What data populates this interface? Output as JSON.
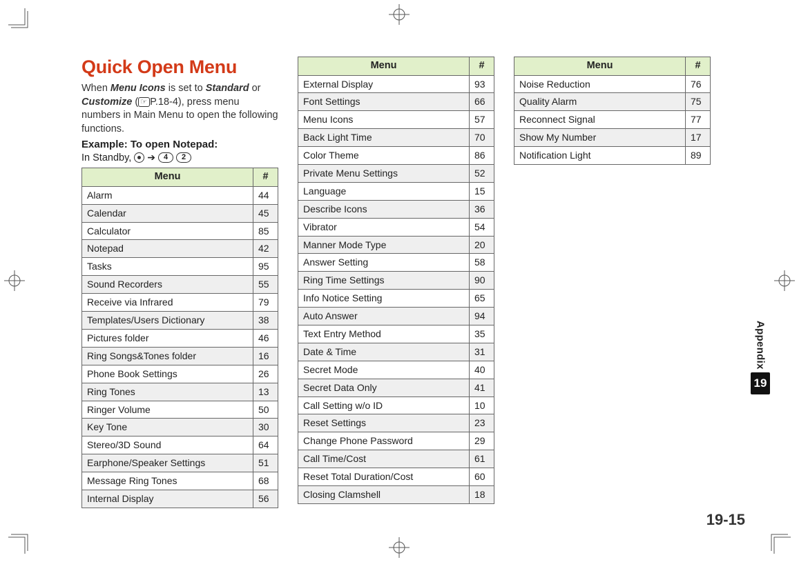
{
  "title": "Quick Open Menu",
  "intro": {
    "pre": "When ",
    "menu_icons": "Menu Icons",
    "mid1": " is set to ",
    "standard": "Standard",
    "or": " or ",
    "customize": "Customize",
    "ref_open": " (",
    "ref_icon_text": "☞",
    "ref_text": "P.18-4), press menu numbers in Main Menu to open the following functions."
  },
  "example_label": "Example: To open Notepad:",
  "standby": {
    "text": "In Standby,",
    "key1": "4",
    "key2": "2"
  },
  "headers": {
    "menu": "Menu",
    "num": "#"
  },
  "table1": [
    {
      "m": "Alarm",
      "n": "44"
    },
    {
      "m": "Calendar",
      "n": "45"
    },
    {
      "m": "Calculator",
      "n": "85"
    },
    {
      "m": "Notepad",
      "n": "42"
    },
    {
      "m": "Tasks",
      "n": "95"
    },
    {
      "m": "Sound Recorders",
      "n": "55"
    },
    {
      "m": "Receive via Infrared",
      "n": "79"
    },
    {
      "m": "Templates/Users Dictionary",
      "n": "38"
    },
    {
      "m": "Pictures folder",
      "n": "46"
    },
    {
      "m": "Ring Songs&Tones folder",
      "n": "16"
    },
    {
      "m": "Phone Book Settings",
      "n": "26"
    },
    {
      "m": "Ring Tones",
      "n": "13"
    },
    {
      "m": "Ringer Volume",
      "n": "50"
    },
    {
      "m": "Key Tone",
      "n": "30"
    },
    {
      "m": "Stereo/3D Sound",
      "n": "64"
    },
    {
      "m": "Earphone/Speaker Settings",
      "n": "51"
    },
    {
      "m": "Message Ring Tones",
      "n": "68"
    },
    {
      "m": "Internal Display",
      "n": "56"
    }
  ],
  "table2": [
    {
      "m": "External Display",
      "n": "93"
    },
    {
      "m": "Font Settings",
      "n": "66"
    },
    {
      "m": "Menu Icons",
      "n": "57"
    },
    {
      "m": "Back Light Time",
      "n": "70"
    },
    {
      "m": "Color Theme",
      "n": "86"
    },
    {
      "m": "Private Menu Settings",
      "n": "52"
    },
    {
      "m": "Language",
      "n": "15"
    },
    {
      "m": "Describe Icons",
      "n": "36"
    },
    {
      "m": "Vibrator",
      "n": "54"
    },
    {
      "m": "Manner Mode Type",
      "n": "20"
    },
    {
      "m": "Answer Setting",
      "n": "58"
    },
    {
      "m": "Ring Time Settings",
      "n": "90"
    },
    {
      "m": "Info Notice Setting",
      "n": "65"
    },
    {
      "m": "Auto Answer",
      "n": "94"
    },
    {
      "m": "Text Entry Method",
      "n": "35"
    },
    {
      "m": "Date & Time",
      "n": "31"
    },
    {
      "m": "Secret Mode",
      "n": "40"
    },
    {
      "m": "Secret Data Only",
      "n": "41"
    },
    {
      "m": "Call Setting w/o ID",
      "n": "10"
    },
    {
      "m": "Reset Settings",
      "n": "23"
    },
    {
      "m": "Change Phone Password",
      "n": "29"
    },
    {
      "m": "Call Time/Cost",
      "n": "61"
    },
    {
      "m": "Reset Total Duration/Cost",
      "n": "60"
    },
    {
      "m": "Closing Clamshell",
      "n": "18"
    }
  ],
  "table3": [
    {
      "m": "Noise Reduction",
      "n": "76"
    },
    {
      "m": "Quality Alarm",
      "n": "75"
    },
    {
      "m": "Reconnect Signal",
      "n": "77"
    },
    {
      "m": "Show My Number",
      "n": "17"
    },
    {
      "m": "Notification Light",
      "n": "89"
    }
  ],
  "sidetab": {
    "label": "Appendix",
    "chapter": "19"
  },
  "page_number": "19-15"
}
